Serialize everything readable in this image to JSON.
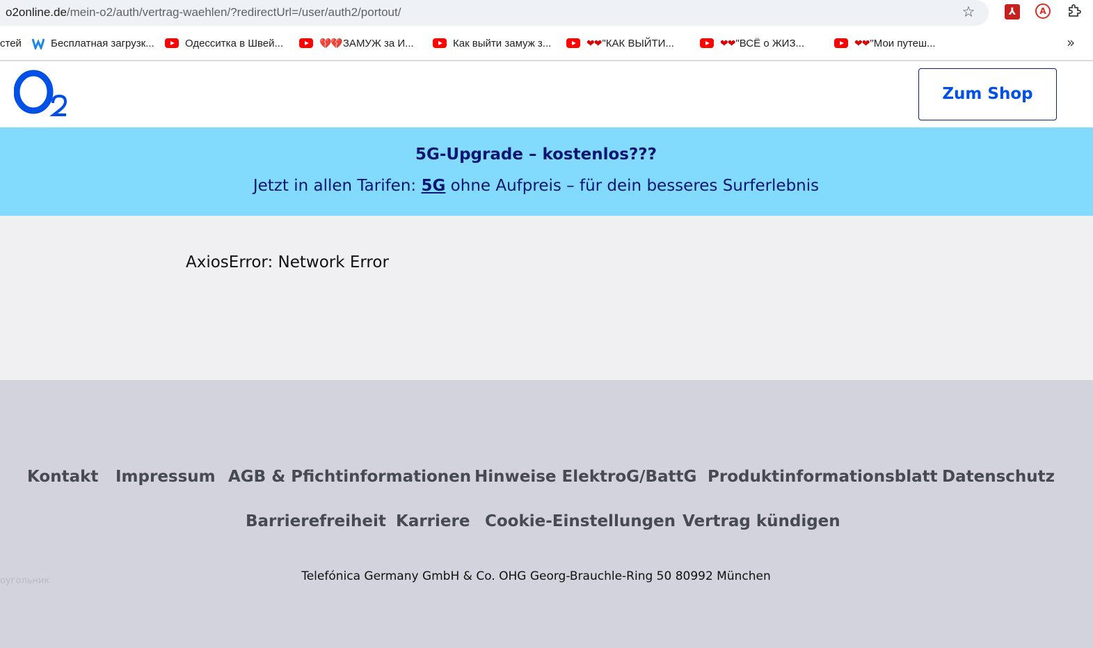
{
  "browser": {
    "url_host": "o2online.de",
    "url_path": "/mein-o2/auth/vertrag-waehlen/?redirectUrl=/user/auth2/portout/",
    "bookmarks": [
      {
        "label": "стей",
        "icon": "none"
      },
      {
        "label": "Бесплатная загрузк...",
        "icon": "w-icon"
      },
      {
        "label": "Одесситка в Швей...",
        "icon": "youtube-icon"
      },
      {
        "label": "ЗАМУЖ за И...",
        "icon": "youtube-icon",
        "hearts": "💔💔"
      },
      {
        "label": "Как выйти замуж з...",
        "icon": "youtube-icon"
      },
      {
        "label": "\"КАК ВЫЙТИ...",
        "icon": "youtube-icon",
        "hearts": "❤❤"
      },
      {
        "label": "\"ВСЁ о ЖИЗ...",
        "icon": "youtube-icon",
        "hearts": "❤❤"
      },
      {
        "label": "\"Мои путеш...",
        "icon": "youtube-icon",
        "hearts": "❤❤"
      }
    ]
  },
  "header": {
    "shop_button": "Zum Shop"
  },
  "banner": {
    "title": "5G-Upgrade – kostenlos???",
    "subtitle_prefix": "Jetzt in allen Tarifen: ",
    "subtitle_link": "5G",
    "subtitle_suffix": " ohne Aufpreis – für dein besseres Surferlebnis"
  },
  "main": {
    "error_text": "AxiosError: Network Error"
  },
  "footer": {
    "links_row1": [
      "Kontakt",
      "Impressum",
      "AGB & Pfichtinformationen",
      "Hinweise ElektroG/BattG",
      "Produktinformationsblatt",
      "Datenschutz"
    ],
    "links_row2": [
      "Barrierefreiheit",
      "Karriere",
      "Cookie-Einstellungen",
      "Vertrag kündigen"
    ],
    "address": "Telefónica Germany GmbH & Co. OHG Georg-Brauchle-Ring 50 80992 München",
    "ghost_text": "оугольник"
  },
  "colors": {
    "brand_blue": "#0050e6",
    "banner_bg": "#82dbfc",
    "banner_text": "#0b1574",
    "footer_bg": "#d2d3dc"
  }
}
